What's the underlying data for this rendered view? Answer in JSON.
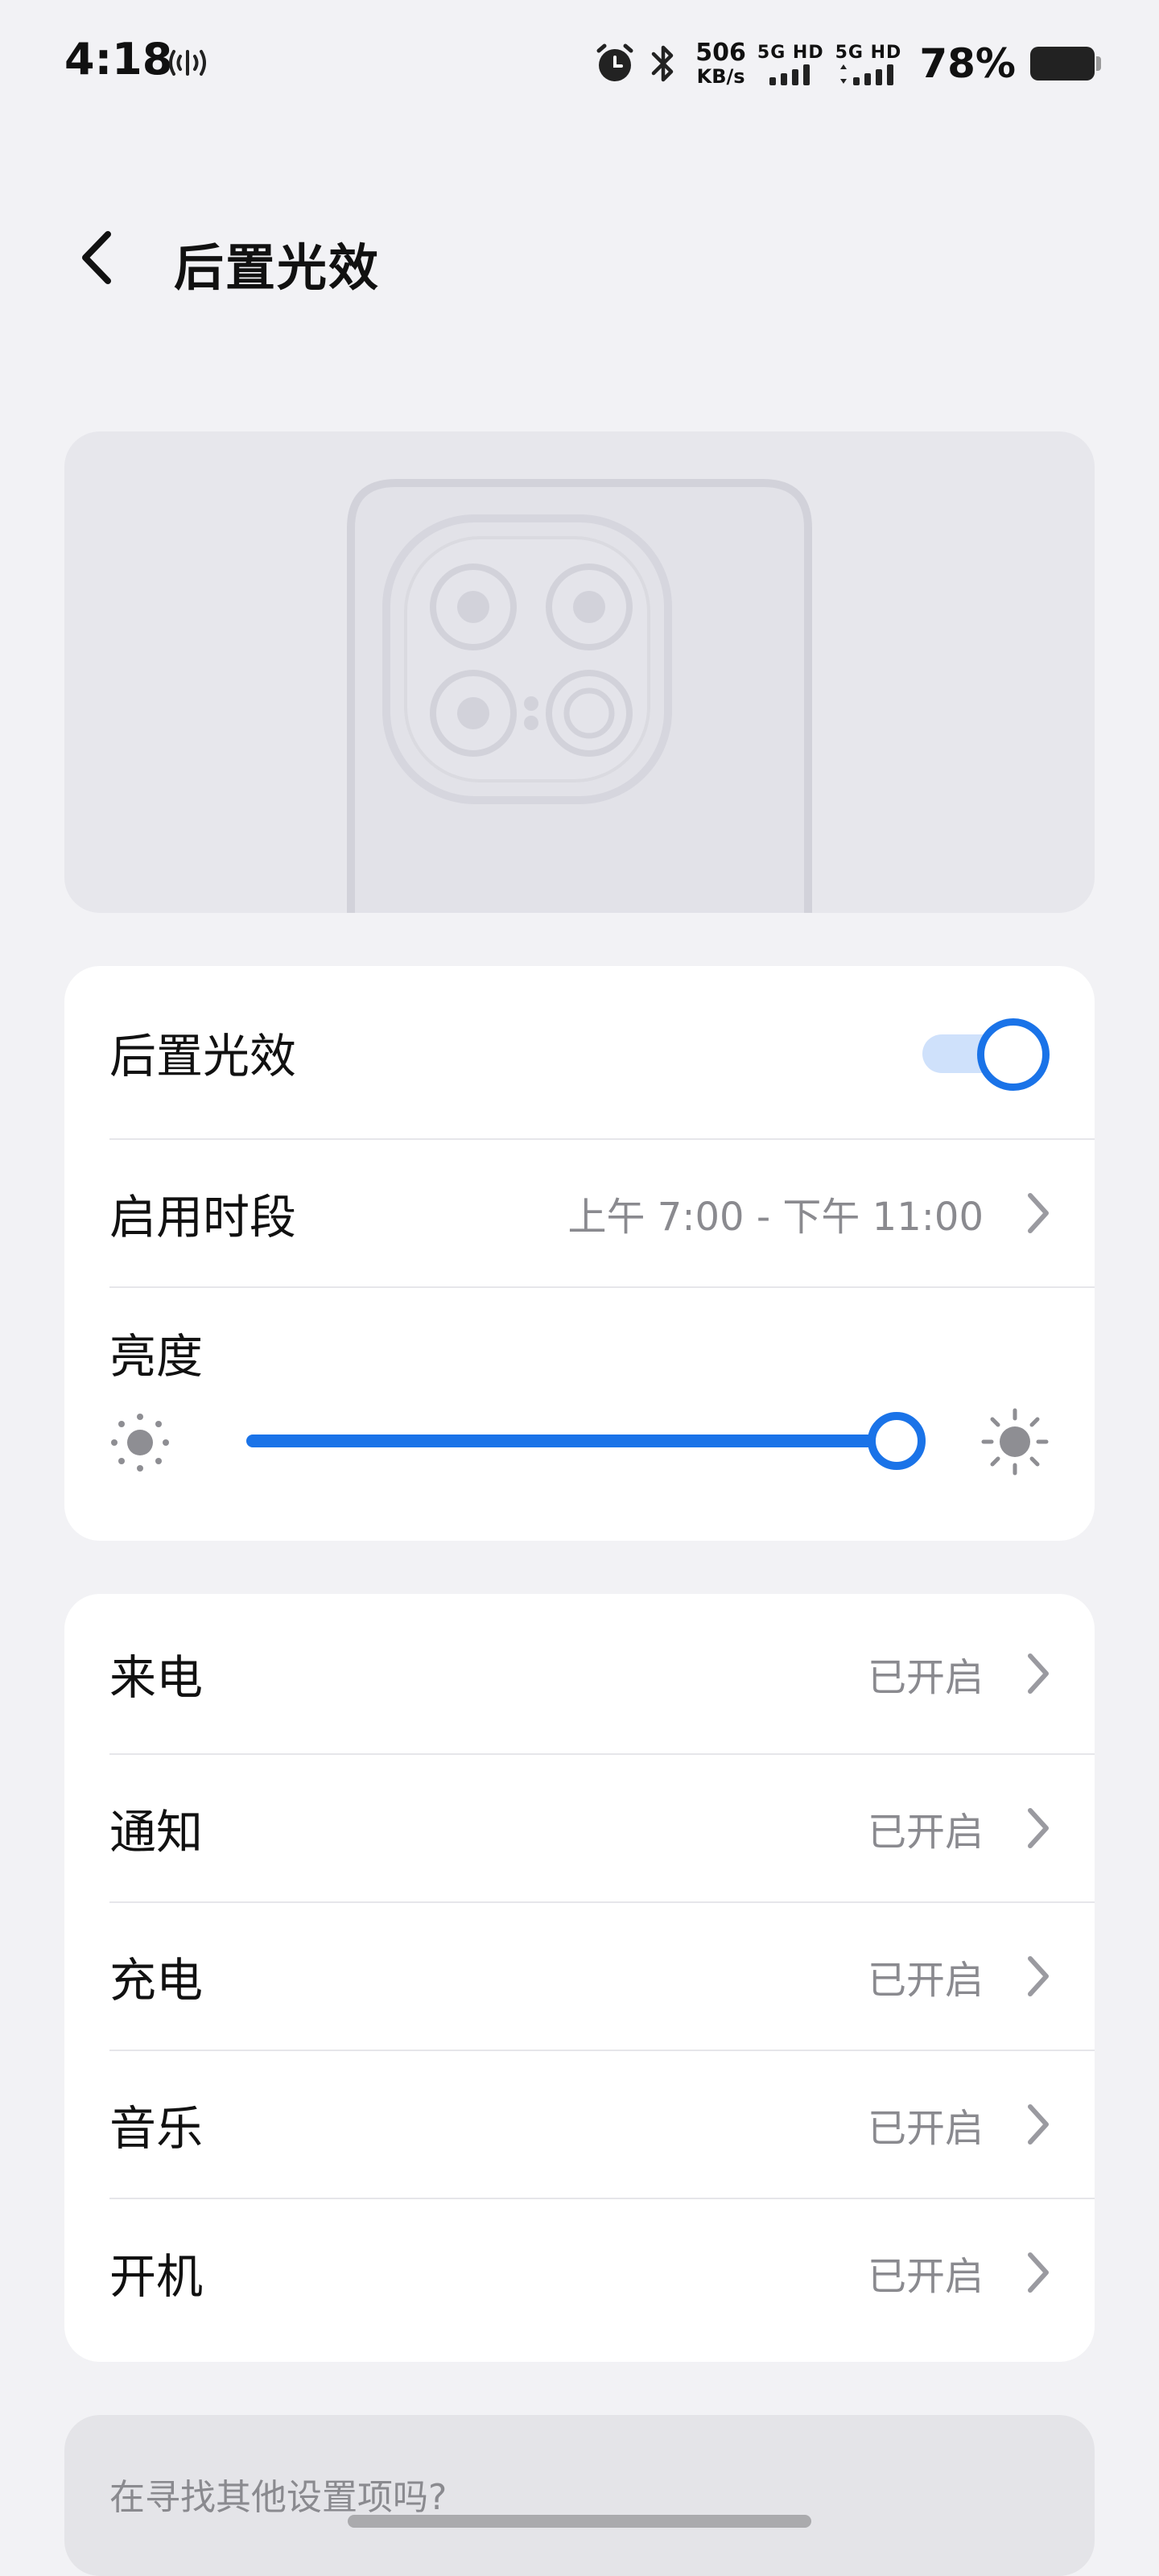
{
  "status_bar": {
    "time": "4:18",
    "net_speed_value": "506",
    "net_speed_unit": "KB/s",
    "sim1_label": "5G HD",
    "sim2_label": "5G HD",
    "battery_pct": "78%",
    "battery_level": 0.78
  },
  "header": {
    "title": "后置光效"
  },
  "main_card": {
    "toggle_label": "后置光效",
    "toggle_on": true,
    "schedule_label": "启用时段",
    "schedule_value": "上午 7:00 - 下午 11:00",
    "brightness_label": "亮度",
    "brightness_level": 1.0
  },
  "effects": [
    {
      "label": "来电",
      "value": "已开启"
    },
    {
      "label": "通知",
      "value": "已开启"
    },
    {
      "label": "充电",
      "value": "已开启"
    },
    {
      "label": "音乐",
      "value": "已开启"
    },
    {
      "label": "开机",
      "value": "已开启"
    }
  ],
  "search_hint": "在寻找其他设置项吗?",
  "colors": {
    "accent": "#1a73e8",
    "background": "#f2f2f5",
    "secondary_text": "#8a8a8f"
  }
}
